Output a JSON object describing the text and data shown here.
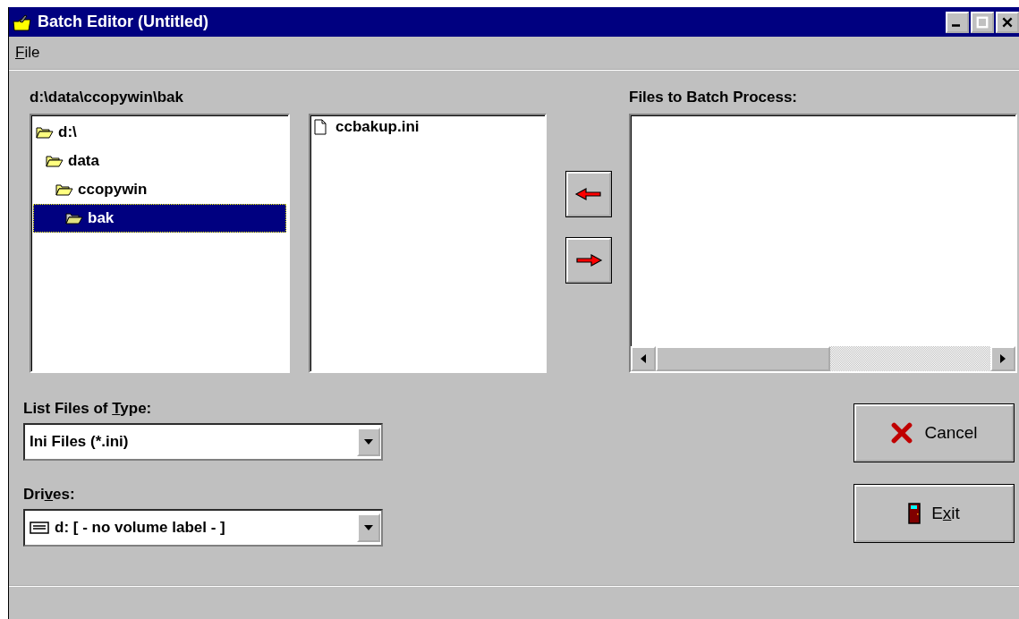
{
  "window": {
    "title": "Batch Editor (Untitled)"
  },
  "menu": [
    {
      "key": "F",
      "after": "ile"
    }
  ],
  "current_path": "d:\\data\\ccopywin\\bak",
  "folders": [
    {
      "name": "d:\\",
      "selected": false,
      "children": [
        {
          "name": "data",
          "selected": false,
          "children": [
            {
              "name": "ccopywin",
              "selected": false,
              "children": [
                {
                  "name": "bak",
                  "selected": true
                }
              ]
            }
          ]
        }
      ]
    }
  ],
  "files": [
    {
      "name": "ccbakup.ini"
    }
  ],
  "batch_list": {
    "label": "Files to Batch Process:"
  },
  "file_type": {
    "label": {
      "before": "List Files of ",
      "key": "T",
      "after": "ype:"
    },
    "value": "Ini Files (*.ini)"
  },
  "drives": {
    "label": {
      "before": "Dri",
      "key": "v",
      "after": "es:"
    },
    "value": "d: [ - no volume label - ]"
  },
  "buttons": [
    {
      "kind": "cancel",
      "label": {
        "before": "Cancel"
      }
    },
    {
      "kind": "exit",
      "label": {
        "before": "E",
        "key": "x",
        "after": "it"
      }
    }
  ]
}
